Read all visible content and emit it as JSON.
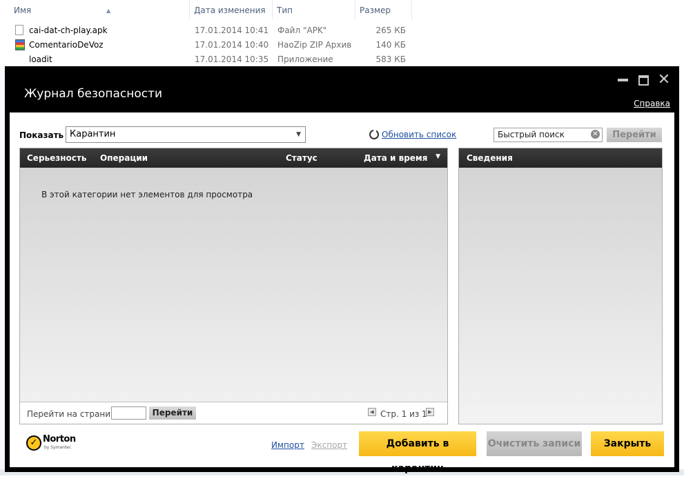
{
  "explorer": {
    "columns": [
      "Имя",
      "Дата изменения",
      "Тип",
      "Размер"
    ],
    "files": [
      {
        "name": "cai-dat-ch-play.apk",
        "date": "17.01.2014 10:41",
        "type": "Файл \"APK\"",
        "size": "265 КБ",
        "icon": "file-icon"
      },
      {
        "name": "ComentarioDeVoz",
        "date": "17.01.2014 10:40",
        "type": "HaoZip ZIP Архив",
        "size": "140 КБ",
        "icon": "zip-archive-icon"
      },
      {
        "name": "loadit",
        "date": "17.01.2014 10:35",
        "type": "Приложение",
        "size": "583 КБ",
        "icon": "application-icon"
      }
    ]
  },
  "window": {
    "title": "Журнал безопасности",
    "help": "Справка"
  },
  "toolbar": {
    "show_label": "Показать",
    "show_value": "Карантин",
    "refresh": "Обновить список",
    "search_placeholder": "Быстрый поиск",
    "go": "Перейти"
  },
  "table": {
    "columns": [
      "Серьезность",
      "Операции",
      "Статус",
      "Дата и время"
    ],
    "empty": "В этой категории нет элементов для просмотра"
  },
  "pager": {
    "label": "Перейти на страницу:",
    "go": "Перейти",
    "page": "Стр. 1 из 1"
  },
  "details": {
    "title": "Сведения"
  },
  "footer": {
    "brand": "Norton",
    "brand_sub": "by Symantec",
    "import": "Импорт",
    "export": "Экспорт",
    "add": "Добавить в карантин",
    "clear": "Очистить записи",
    "close": "Закрыть"
  },
  "colors": {
    "accent": "#f7b818",
    "titlebar": "#000000",
    "link": "#1f4ea0"
  }
}
